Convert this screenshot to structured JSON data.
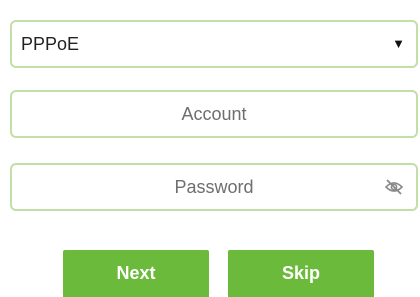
{
  "connection_type": {
    "selected": "PPPoE",
    "arrow_icon": "caret-down-icon"
  },
  "account": {
    "placeholder": "Account",
    "value": ""
  },
  "password": {
    "placeholder": "Password",
    "value": "",
    "toggle_icon": "eye-slash-icon"
  },
  "buttons": {
    "next_label": "Next",
    "skip_label": "Skip"
  },
  "colors": {
    "field_border": "#c3dfa8",
    "button_bg": "#6cba3b",
    "button_text": "#ffffff",
    "placeholder_text": "#6e6e6e"
  }
}
